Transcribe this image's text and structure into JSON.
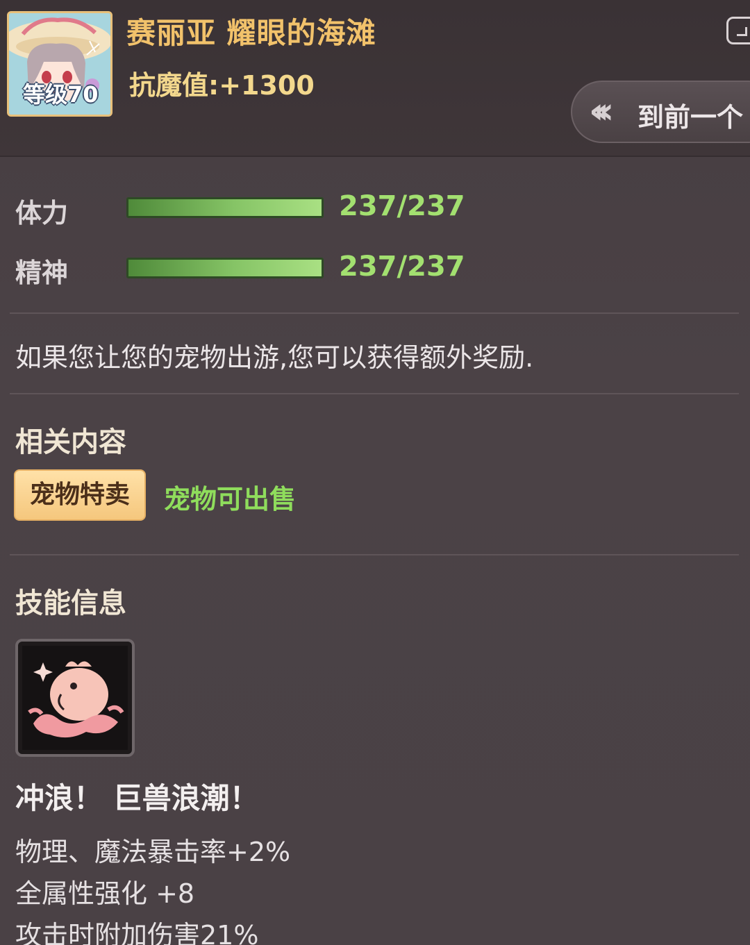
{
  "header": {
    "pet_name": "赛丽亚 耀眼的海滩",
    "resist_value": "抗魔值:+1300",
    "avatar_level": "等级70",
    "prev_button_label": "到前一个"
  },
  "stats": [
    {
      "label": "体力",
      "value": "237/237",
      "fraction": 1.0
    },
    {
      "label": "精神",
      "value": "237/237",
      "fraction": 1.0
    }
  ],
  "notice": "如果您让您的宠物出游,您可以获得额外奖励.",
  "related": {
    "title": "相关内容",
    "button_label": "宠物特卖",
    "sellable_text": "宠物可出售"
  },
  "skill": {
    "section_title": "技能信息",
    "icon": "pink-wave-creature-icon",
    "name": "冲浪！ 巨兽浪潮！",
    "effects": [
      "物理、魔法暴击率+2%",
      "全属性强化 +8",
      "攻击时附加伤害21%"
    ]
  },
  "colors": {
    "name_gold": "#f2c26b",
    "bar_green": "#86c466",
    "value_green": "#a3e070",
    "tag_orange": "#f5c77d"
  }
}
